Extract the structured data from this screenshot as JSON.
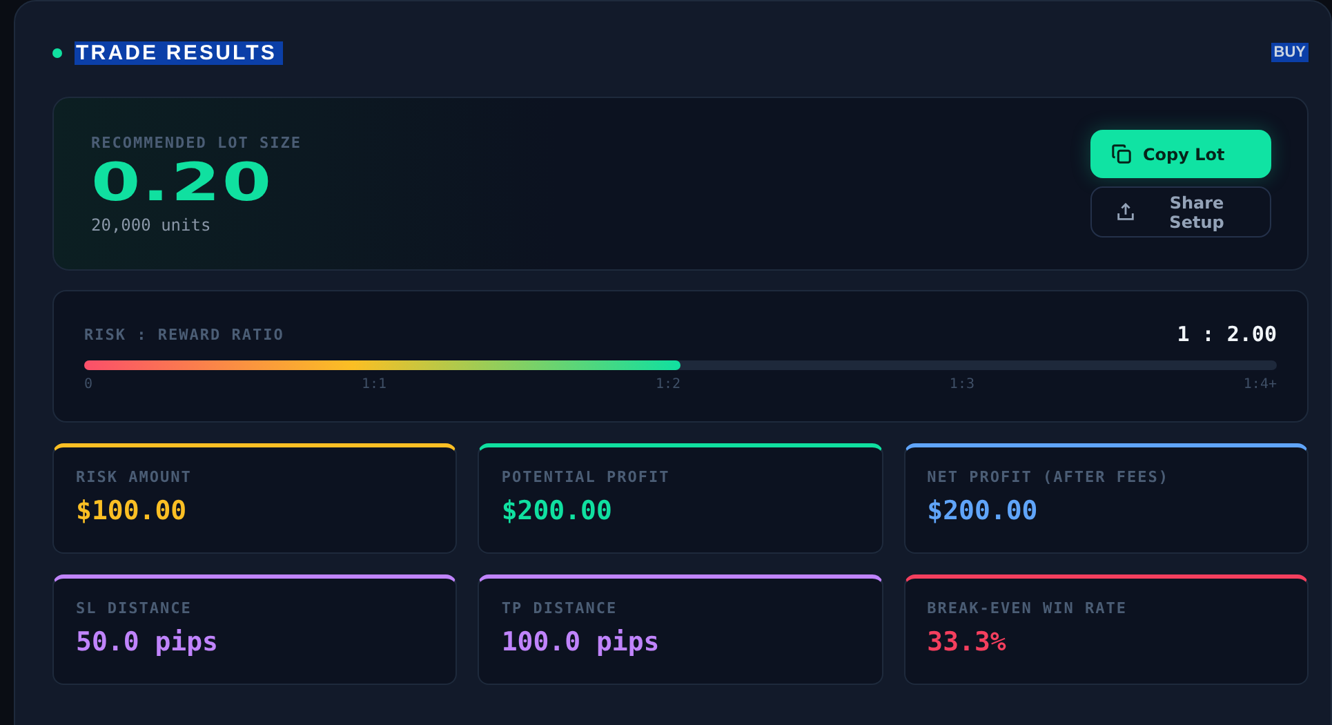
{
  "header": {
    "title": "TRADE RESULTS",
    "title_highlighted": true,
    "badge": "BUY",
    "badge_highlighted": true
  },
  "lot": {
    "label": "RECOMMENDED LOT SIZE",
    "value": "0.20",
    "units": "20,000 units",
    "buttons": [
      {
        "label": "Copy Lot",
        "kind": "primary"
      },
      {
        "label": "Share Setup",
        "kind": "secondary"
      }
    ]
  },
  "ratio": {
    "label": "RISK : REWARD RATIO",
    "reading": "1 : 2.00",
    "level": 0.5,
    "ticks": [
      "0",
      "1:1",
      "1:2",
      "1:3",
      "1:4+"
    ]
  },
  "metrics": [
    {
      "label": "RISK AMOUNT",
      "value": "$100.00",
      "color": "#fbbf24"
    },
    {
      "label": "POTENTIAL PROFIT",
      "value": "$200.00",
      "color": "#10e0a0"
    },
    {
      "label": "NET PROFIT (AFTER FEES)",
      "value": "$200.00",
      "color": "#60a5fa"
    },
    {
      "label": "SL DISTANCE",
      "value": "50.0 pips",
      "color": "#c084fc"
    },
    {
      "label": "TP DISTANCE",
      "value": "100.0 pips",
      "color": "#c084fc"
    },
    {
      "label": "BREAK-EVEN WIN RATE",
      "value": "33.3%",
      "color": "#f43f5e"
    }
  ]
}
